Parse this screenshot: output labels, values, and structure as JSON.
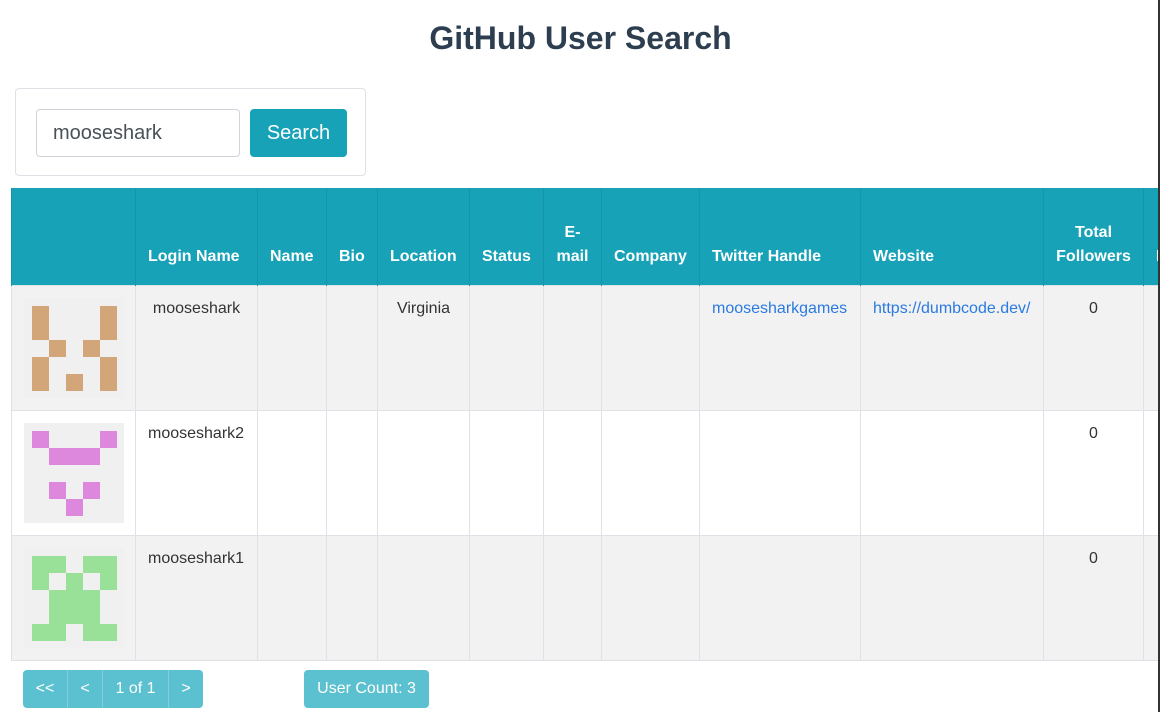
{
  "page": {
    "title": "GitHub User Search"
  },
  "search": {
    "value": "mooseshark",
    "button_label": "Search"
  },
  "table": {
    "headers": [
      "",
      "Login Name",
      "Name",
      "Bio",
      "Location",
      "Status",
      "E-mail",
      "Company",
      "Twitter Handle",
      "Website",
      "Total Followers",
      "I"
    ],
    "rows": [
      {
        "avatar_color": "#d2a679",
        "avatar_pattern": "a",
        "login": "mooseshark",
        "name": "",
        "bio": "",
        "location": "Virginia",
        "status": "",
        "email": "",
        "company": "",
        "twitter": "moosesharkgames",
        "website": "https://dumbcode.dev/",
        "followers": "0",
        "extra": ""
      },
      {
        "avatar_color": "#dd88dd",
        "avatar_pattern": "b",
        "login": "mooseshark2",
        "name": "",
        "bio": "",
        "location": "",
        "status": "",
        "email": "",
        "company": "",
        "twitter": "",
        "website": "",
        "followers": "0",
        "extra": ""
      },
      {
        "avatar_color": "#99e099",
        "avatar_pattern": "c",
        "login": "mooseshark1",
        "name": "",
        "bio": "",
        "location": "",
        "status": "",
        "email": "",
        "company": "",
        "twitter": "",
        "website": "",
        "followers": "0",
        "extra": ""
      }
    ]
  },
  "pagination": {
    "first": "<<",
    "prev": "<",
    "page": "1 of 1",
    "next": ">"
  },
  "user_count": "User Count: 3"
}
